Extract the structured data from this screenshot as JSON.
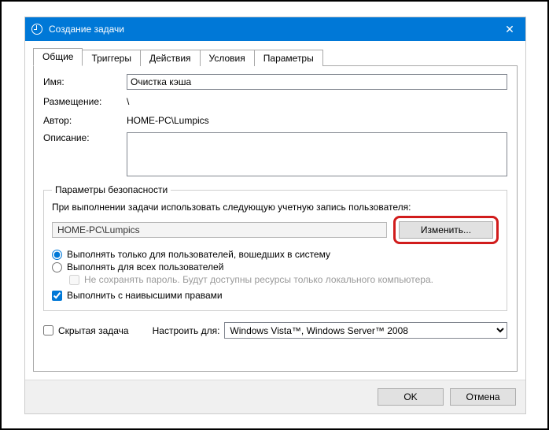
{
  "window": {
    "title": "Создание задачи",
    "close_symbol": "✕"
  },
  "tabs": {
    "general": "Общие",
    "triggers": "Триггеры",
    "actions": "Действия",
    "conditions": "Условия",
    "settings": "Параметры"
  },
  "labels": {
    "name": "Имя:",
    "location": "Размещение:",
    "author": "Автор:",
    "description": "Описание:"
  },
  "values": {
    "name": "Очистка кэша",
    "location": "\\",
    "author": "HOME-PC\\Lumpics",
    "description": ""
  },
  "security": {
    "legend": "Параметры безопасности",
    "run_as_line": "При выполнении задачи использовать следующую учетную запись пользователя:",
    "account": "HOME-PC\\Lumpics",
    "change_btn": "Изменить...",
    "radio_logged_on": "Выполнять только для пользователей, вошедших в систему",
    "radio_all": "Выполнять для всех пользователей",
    "no_store_pwd": "Не сохранять пароль. Будут доступны ресурсы только локального компьютера.",
    "highest_priv": "Выполнить с наивысшими правами"
  },
  "bottom": {
    "hidden": "Скрытая задача",
    "configure_for": "Настроить для:",
    "configure_value": "Windows Vista™, Windows Server™ 2008"
  },
  "buttons": {
    "ok": "OK",
    "cancel": "Отмена"
  }
}
